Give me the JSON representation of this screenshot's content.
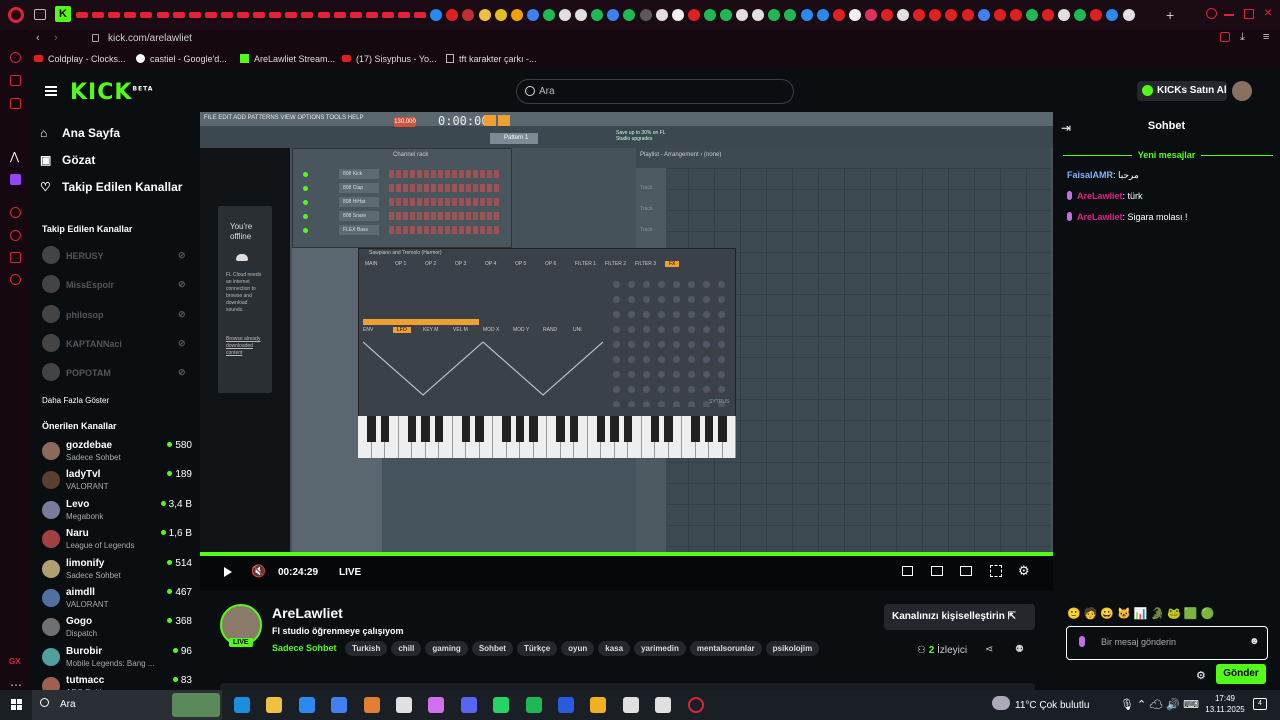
{
  "browser": {
    "url": "kick.com/arelawliet",
    "bookmarks": [
      "Coldplay - Clocks...",
      "castiel - Google'd...",
      "AreLawliet Stream...",
      "(17) Sisyphus - Yo...",
      "tft karakter çarkı -..."
    ]
  },
  "header": {
    "logo": "KICK",
    "logo_badge": "BETA",
    "search_placeholder": "Ara",
    "buy_label": "KICKs Satın Al"
  },
  "sidebar": {
    "nav": [
      {
        "label": "Ana Sayfa",
        "icon": "home-icon"
      },
      {
        "label": "Gözat",
        "icon": "browse-icon"
      },
      {
        "label": "Takip Edilen Kanallar",
        "icon": "heart-icon"
      }
    ],
    "followed_title": "Takip Edilen Kanallar",
    "followed": [
      "HERUSY",
      "MissEspoir",
      "philosop",
      "KAPTANNaci",
      "POPOTAM"
    ],
    "show_more": "Daha Fazla Göster",
    "recommended_title": "Önerilen Kanallar",
    "recommended": [
      {
        "name": "gozdebae",
        "category": "Sadece Sohbet",
        "viewers": "580",
        "color": "#8a6a5a"
      },
      {
        "name": "ladyTvl",
        "category": "VALORANT",
        "viewers": "189",
        "color": "#5a4030"
      },
      {
        "name": "Levo",
        "category": "Megabonk",
        "viewers": "3,4 B",
        "color": "#7a7a9a"
      },
      {
        "name": "Naru",
        "category": "League of Legends",
        "viewers": "1,6 B",
        "color": "#a04040"
      },
      {
        "name": "limonify",
        "category": "Sadece Sohbet",
        "viewers": "514",
        "color": "#b0a070"
      },
      {
        "name": "aimdll",
        "category": "VALORANT",
        "viewers": "467",
        "color": "#5070a0"
      },
      {
        "name": "Gogo",
        "category": "Dispatch",
        "viewers": "368",
        "color": "#707070"
      },
      {
        "name": "Burobir",
        "category": "Mobile Legends: Bang ...",
        "viewers": "96",
        "color": "#50a0a0"
      },
      {
        "name": "tutmacc",
        "category": "ARC Raiders",
        "viewers": "83",
        "color": "#a06050"
      }
    ]
  },
  "player": {
    "time": "00:24:29",
    "live": "LIVE",
    "offline_title": "You're offline",
    "offline_text": "FL Cloud needs an internet connection to browse and download sounds.",
    "offline_link": "Browse already downloaded content",
    "daw_menu": "FILE EDIT ADD PATTERNS VIEW OPTIONS TOOLS HELP",
    "daw_time": "0:00:00",
    "daw_tempo": "130.000",
    "daw_pattern": "Pattern 1",
    "daw_hint": "Save up to 30% on FL Studio upgrades",
    "channel_rack": "Channel rack",
    "playlist": "Playlist - Arrangement › (none)",
    "rack_channels": [
      "808 Kick",
      "808 Clap",
      "808 HiHat",
      "808 Snare",
      "FLEX Bass"
    ],
    "synth_title": "Sawpiano and Tremolo (Harmor)",
    "synth_tabs": [
      "MAIN",
      "OP 1",
      "OP 2",
      "OP 3",
      "OP 4",
      "OP 5",
      "OP 6",
      "FILTER 1",
      "FILTER 2",
      "FILTER 3",
      "FX"
    ],
    "synth_subtabs": [
      "ENV",
      "LFO",
      "KEY M",
      "VEL M",
      "MOD X",
      "MOD Y",
      "RAND",
      "UNI"
    ],
    "synth_brand": "SYTRUS",
    "track_label": "Track"
  },
  "channel": {
    "name": "AreLawliet",
    "title": "Fl studio öğrenmeye çalışıyom",
    "category": "Sadece Sohbet",
    "tags": [
      "Turkish",
      "chill",
      "gaming",
      "Sohbet",
      "Türkçe",
      "oyun",
      "kasa",
      "yarimedin",
      "mentalsorunlar",
      "psikolojim"
    ],
    "live_badge": "LIVE",
    "customize": "Kanalınızı kişiselleştirin",
    "viewers": "2",
    "viewers_label": "İzleyici"
  },
  "chat": {
    "title": "Sohbet",
    "new_messages": "Yeni mesajlar",
    "messages": [
      {
        "user": "FaisalAMR",
        "text": "مرحبا",
        "color": "#7fb4ff",
        "mic": false
      },
      {
        "user": "AreLawliet",
        "text": "türk",
        "color": "#e0208c",
        "mic": true
      },
      {
        "user": "AreLawliet",
        "text": "Sigara molası !",
        "color": "#e0208c",
        "mic": true
      }
    ],
    "input_placeholder": "Bir mesaj gönderin",
    "send": "Gönder"
  },
  "taskbar": {
    "search": "Ara",
    "weather": "11°C  Çok bulutlu",
    "time": "17:49",
    "date": "13.11.2025",
    "notifications": "4"
  },
  "colors": {
    "accent": "#53fc18",
    "bg": "#0b0e11",
    "tabbar": "#1b0b14"
  }
}
